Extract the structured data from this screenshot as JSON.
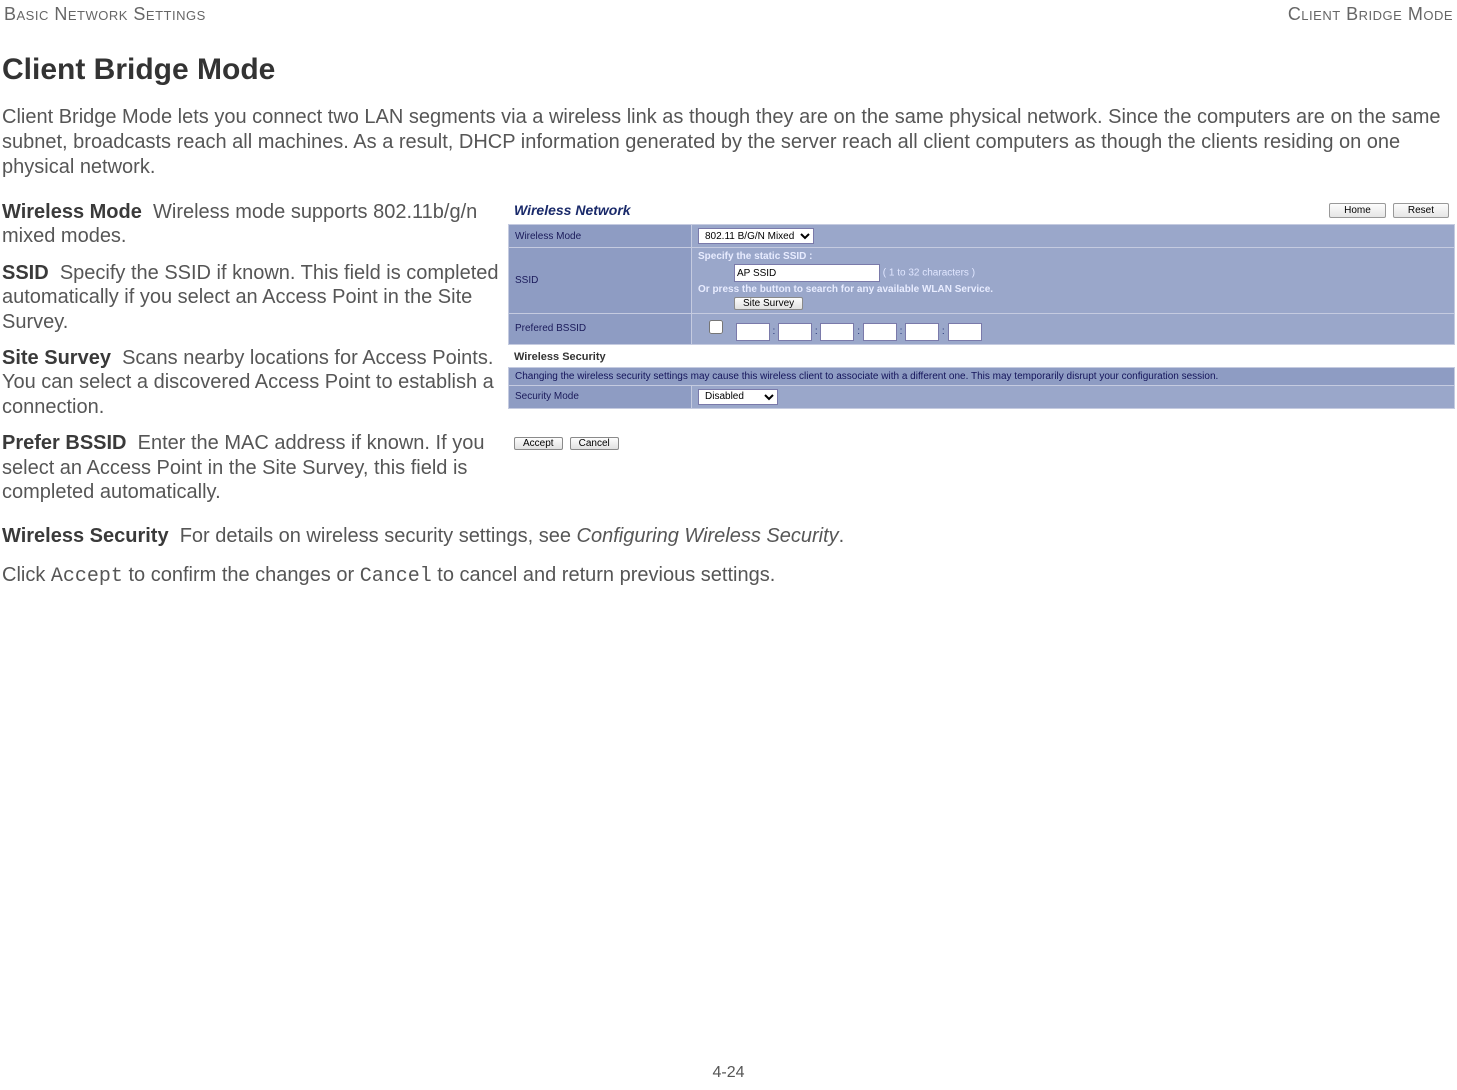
{
  "header": {
    "left": "Basic Network Settings",
    "right": "Client Bridge Mode"
  },
  "title": "Client Bridge Mode",
  "intro": "Client Bridge Mode lets you connect two LAN segments via a wireless link as though they are on the same physical network. Since the computers are on the same subnet, broadcasts reach all machines. As a result, DHCP information generated by the server reach all client computers as though the clients residing on one physical network.",
  "defs": {
    "wireless_mode": {
      "term": "Wireless Mode",
      "text": "Wireless mode supports 802.11b/g/n mixed modes."
    },
    "ssid": {
      "term": "SSID",
      "text": "Specify the SSID if known. This field is completed automatically if you select an Access Point in the Site Survey."
    },
    "site_survey": {
      "term": "Site Survey",
      "text": "Scans nearby locations for Access Points. You can select a discovered Access Point to establish a connection."
    },
    "prefer_bssid": {
      "term": "Prefer BSSID",
      "text": "Enter the MAC address if known. If you select an Access Point in the Site Survey, this field is completed automatically."
    },
    "wireless_security": {
      "term": "Wireless Security",
      "text": "For details on wireless security settings, see ",
      "link": "Configuring Wireless Security",
      "after": "."
    },
    "closing_pre": "Click ",
    "accept_word": "Accept",
    "closing_mid": " to confirm the changes or ",
    "cancel_word": "Cancel",
    "closing_post": " to cancel and return previous settings."
  },
  "panel": {
    "section_title": "Wireless Network",
    "home_btn": "Home",
    "reset_btn": "Reset",
    "rows": {
      "wireless_mode_lbl": "Wireless Mode",
      "wireless_mode_val": "802.11 B/G/N Mixed",
      "ssid_lbl": "SSID",
      "ssid_line1": "Specify the static SSID :",
      "ssid_value": "AP SSID",
      "ssid_hint": "( 1 to 32 characters )",
      "ssid_line2": "Or press the button to search for any available WLAN Service.",
      "site_survey_btn": "Site Survey",
      "bssid_lbl": "Prefered BSSID",
      "sec_header": "Wireless Security",
      "warn": "Changing the wireless security settings may cause this wireless client to associate with a different one. This may temporarily disrupt your configuration session.",
      "sec_mode_lbl": "Security Mode",
      "sec_mode_val": "Disabled",
      "accept_btn": "Accept",
      "cancel_btn": "Cancel"
    }
  },
  "footer": "4-24"
}
